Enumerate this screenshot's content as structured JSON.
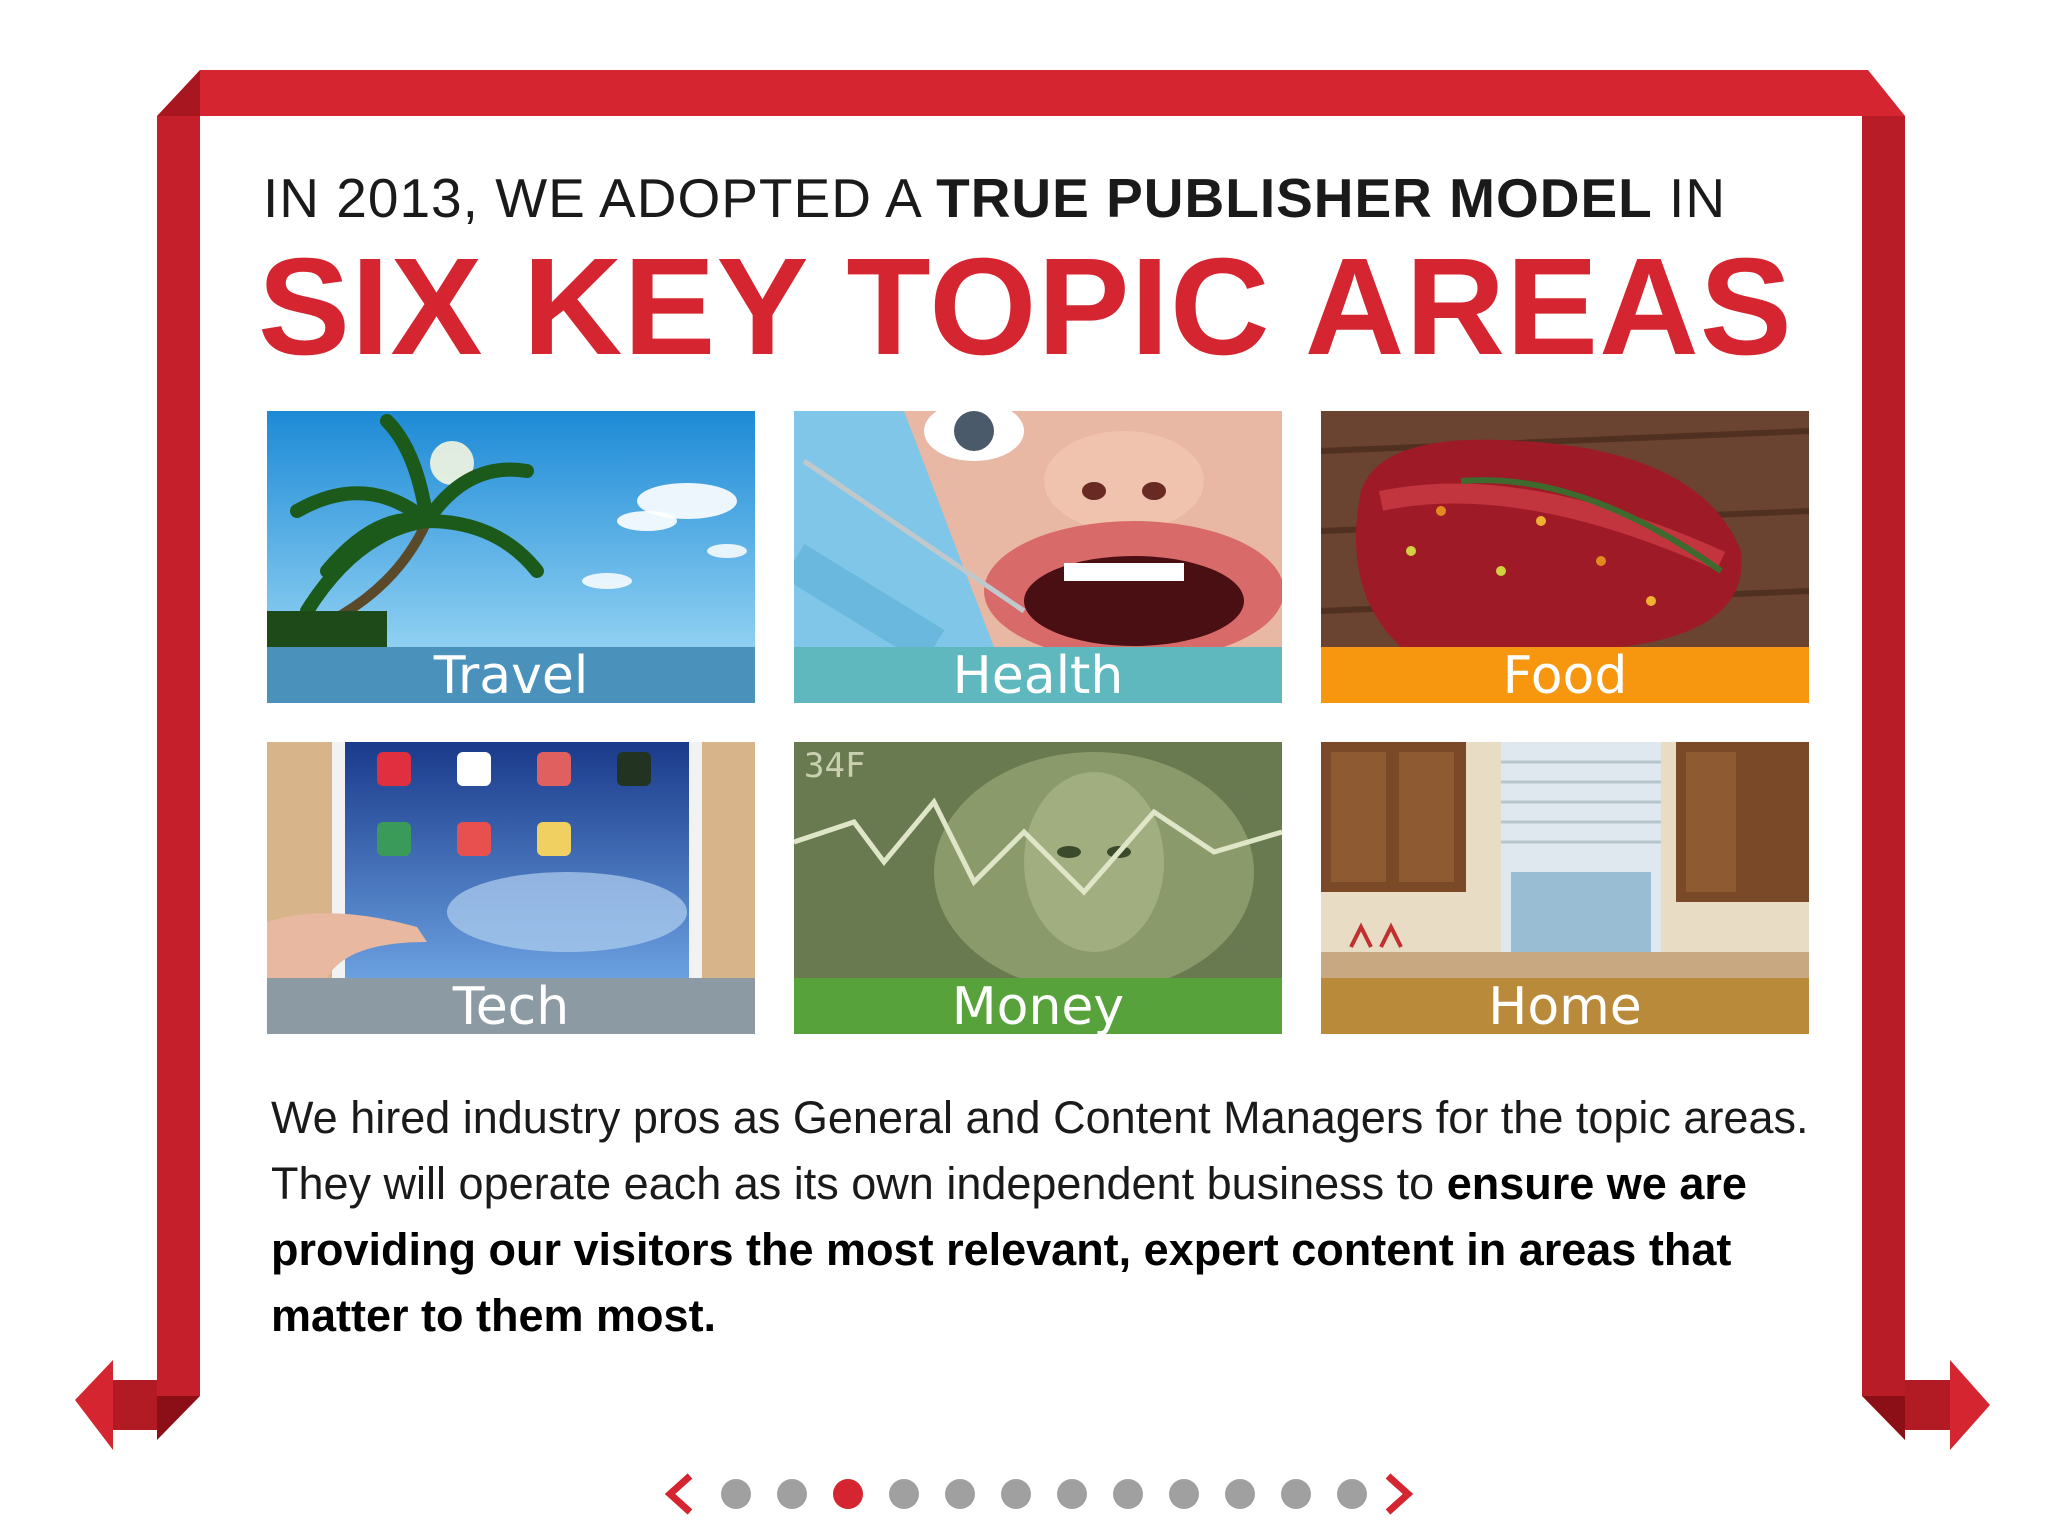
{
  "headline": {
    "prefix": "IN 2013, WE ADOPTED A ",
    "bold": "TRUE PUBLISHER MODEL",
    "suffix": " IN"
  },
  "title": "SIX KEY TOPIC AREAS",
  "topics": [
    {
      "label": "Travel",
      "color": "#4a92bb"
    },
    {
      "label": "Health",
      "color": "#5fb8bd"
    },
    {
      "label": "Food",
      "color": "#f7960f"
    },
    {
      "label": "Tech",
      "color": "#8c9aa3"
    },
    {
      "label": "Money",
      "color": "#58a23b"
    },
    {
      "label": "Home",
      "color": "#b88a3a"
    }
  ],
  "body": {
    "plain": "We hired industry pros as General and Content Managers for the topic areas. They will operate each as its own independent business to ",
    "bold": "ensure we are providing our visitors the most relevant, expert content in areas that matter to them most."
  },
  "pager": {
    "total": 12,
    "active": 3,
    "prev_icon": "chevron-left-icon",
    "next_icon": "chevron-right-icon"
  },
  "accent_color": "#d42530"
}
